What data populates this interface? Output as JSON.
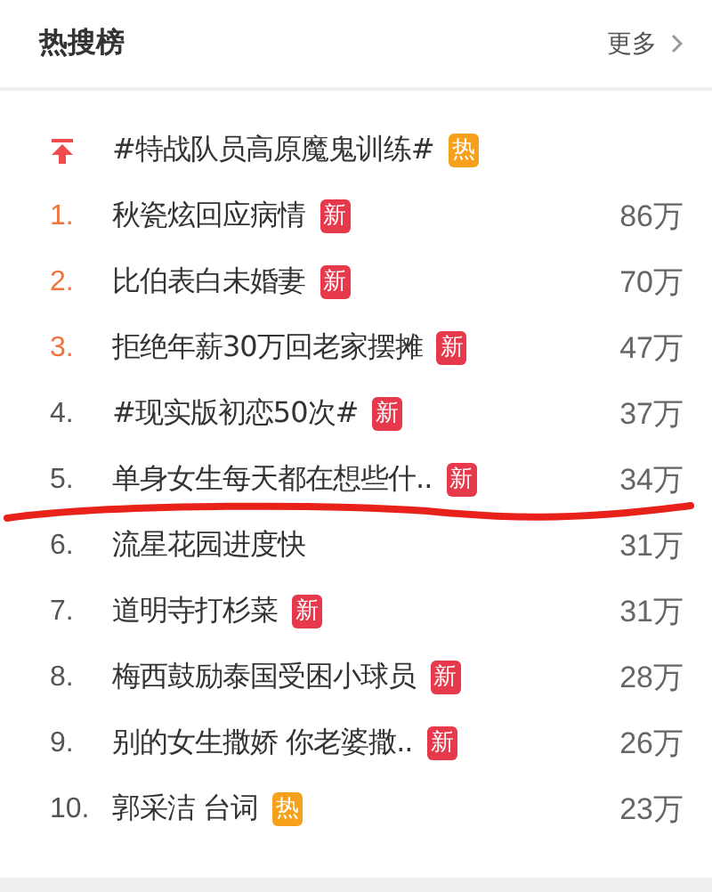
{
  "header": {
    "title": "热搜榜",
    "more": "更多"
  },
  "items": [
    {
      "kind": "pinned",
      "title": "#特战队员高原魔鬼训练#",
      "badge": {
        "kind": "hot",
        "text": "热"
      }
    },
    {
      "kind": "ranked",
      "rank": "1.",
      "top": true,
      "title": "秋瓷炫回应病情",
      "badge": {
        "kind": "new",
        "text": "新"
      },
      "count": "86万"
    },
    {
      "kind": "ranked",
      "rank": "2.",
      "top": true,
      "title": "比伯表白未婚妻",
      "badge": {
        "kind": "new",
        "text": "新"
      },
      "count": "70万"
    },
    {
      "kind": "ranked",
      "rank": "3.",
      "top": true,
      "title": "拒绝年薪30万回老家摆摊",
      "badge": {
        "kind": "new",
        "text": "新"
      },
      "count": "47万"
    },
    {
      "kind": "ranked",
      "rank": "4.",
      "top": false,
      "title": "#现实版初恋50次#",
      "badge": {
        "kind": "new",
        "text": "新"
      },
      "count": "37万"
    },
    {
      "kind": "ranked",
      "rank": "5.",
      "top": false,
      "title": "单身女生每天都在想些什..",
      "badge": {
        "kind": "new",
        "text": "新"
      },
      "count": "34万"
    },
    {
      "kind": "ranked",
      "rank": "6.",
      "top": false,
      "title": "流星花园进度快",
      "count": "31万"
    },
    {
      "kind": "ranked",
      "rank": "7.",
      "top": false,
      "title": "道明寺打杉菜",
      "badge": {
        "kind": "new",
        "text": "新"
      },
      "count": "31万"
    },
    {
      "kind": "ranked",
      "rank": "8.",
      "top": false,
      "title": "梅西鼓励泰国受困小球员",
      "badge": {
        "kind": "new",
        "text": "新"
      },
      "count": "28万"
    },
    {
      "kind": "ranked",
      "rank": "9.",
      "top": false,
      "title": "别的女生撒娇 你老婆撒..",
      "badge": {
        "kind": "new",
        "text": "新"
      },
      "count": "26万"
    },
    {
      "kind": "ranked",
      "rank": "10.",
      "top": false,
      "title": "郭采洁 台词",
      "badge": {
        "kind": "hot",
        "text": "热"
      },
      "count": "23万"
    }
  ]
}
